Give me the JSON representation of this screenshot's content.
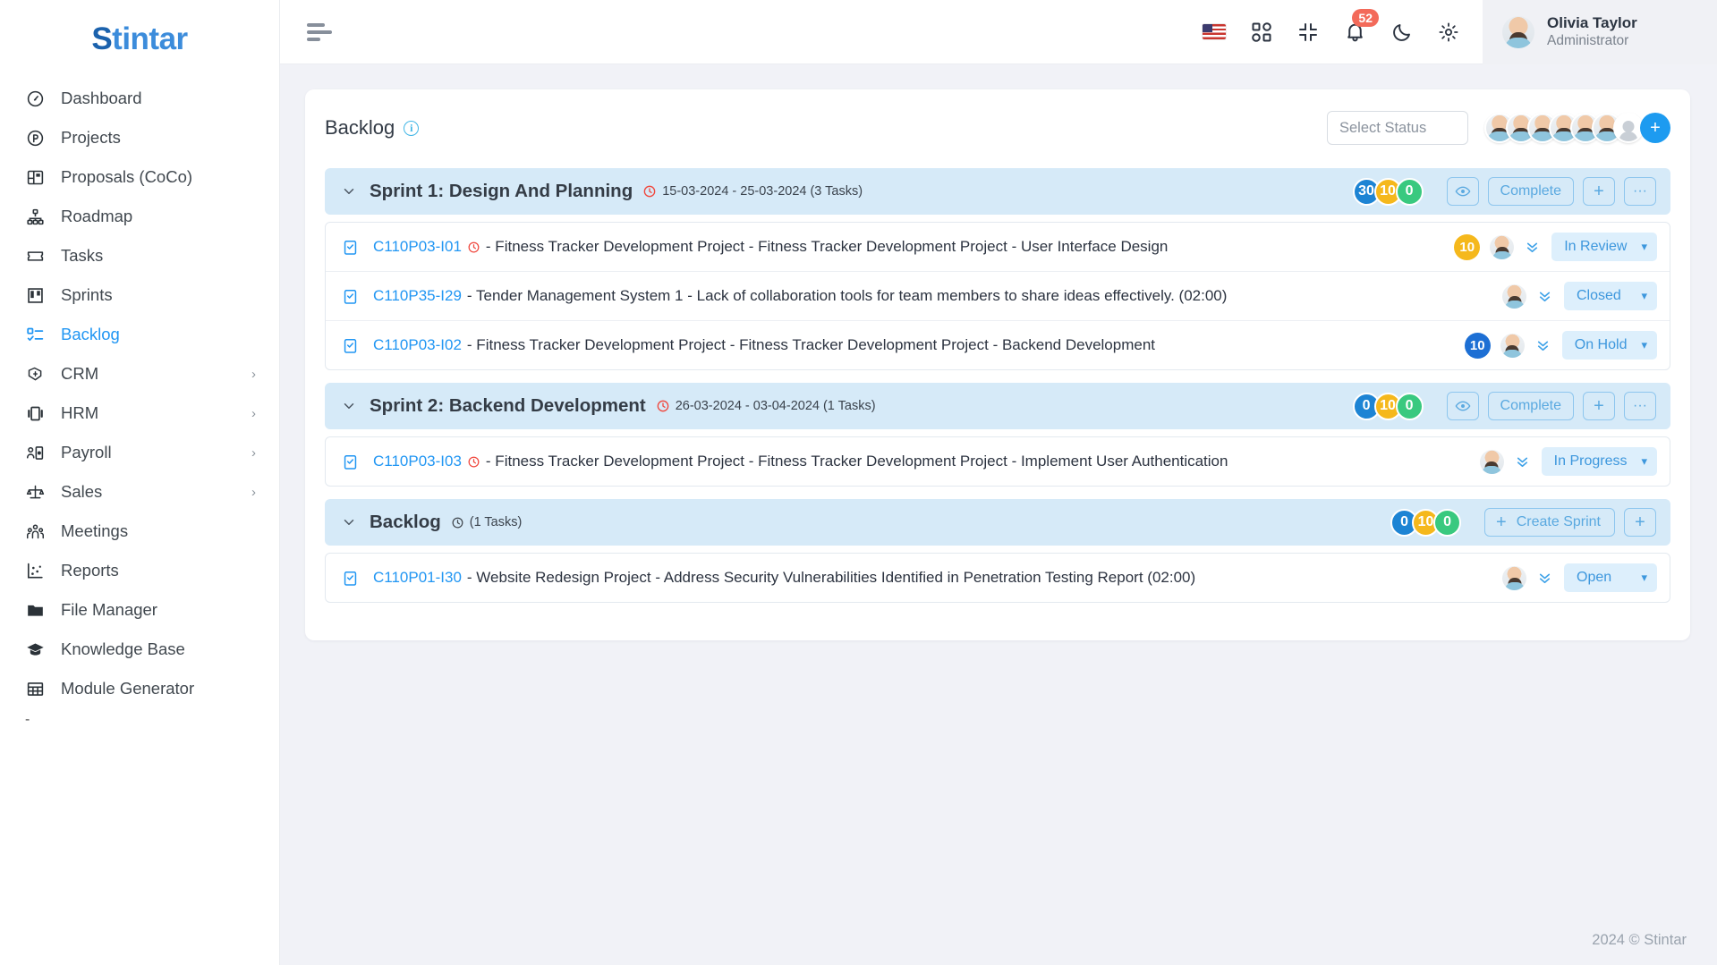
{
  "brand": {
    "prefix": "S",
    "rest": "tintar"
  },
  "sidebar": {
    "items": [
      {
        "label": "Dashboard",
        "icon": "gauge-icon",
        "active": false,
        "caret": ""
      },
      {
        "label": "Projects",
        "icon": "circle-p-icon",
        "active": false,
        "caret": ""
      },
      {
        "label": "Proposals (CoCo)",
        "icon": "layout-icon",
        "active": false,
        "caret": ""
      },
      {
        "label": "Roadmap",
        "icon": "sitemap-icon",
        "active": false,
        "caret": ""
      },
      {
        "label": "Tasks",
        "icon": "ticket-icon",
        "active": false,
        "caret": ""
      },
      {
        "label": "Sprints",
        "icon": "board-icon",
        "active": false,
        "caret": ""
      },
      {
        "label": "Backlog",
        "icon": "checklist-icon",
        "active": true,
        "caret": ""
      },
      {
        "label": "CRM",
        "icon": "handshake-icon",
        "active": false,
        "caret": "›"
      },
      {
        "label": "HRM",
        "icon": "id-card-icon",
        "active": false,
        "caret": "›"
      },
      {
        "label": "Payroll",
        "icon": "payroll-icon",
        "active": false,
        "caret": "›"
      },
      {
        "label": "Sales",
        "icon": "scales-icon",
        "active": false,
        "caret": "›"
      },
      {
        "label": "Meetings",
        "icon": "people-icon",
        "active": false,
        "caret": ""
      },
      {
        "label": "Reports",
        "icon": "scatter-chart-icon",
        "active": false,
        "caret": ""
      },
      {
        "label": "File Manager",
        "icon": "folder-icon",
        "active": false,
        "caret": ""
      },
      {
        "label": "Knowledge Base",
        "icon": "graduation-cap-icon",
        "active": false,
        "caret": ""
      },
      {
        "label": "Module Generator",
        "icon": "grid-table-icon",
        "active": false,
        "caret": ""
      }
    ],
    "trailing": "-"
  },
  "topbar": {
    "menu_toggle": "hamburger-icon",
    "language_flag": "us-flag-icon",
    "apps_icon": "apps-grid-icon",
    "collapse_icon": "collapse-icon",
    "notification_icon": "bell-icon",
    "notification_count": "52",
    "theme_icon": "moon-icon",
    "settings_icon": "gear-icon",
    "user": {
      "name": "Olivia Taylor",
      "role": "Administrator"
    }
  },
  "page": {
    "title": "Backlog",
    "info_glyph": "i",
    "status_filter_placeholder": "Select Status",
    "avatar_count": 6,
    "add_member_label": "+"
  },
  "groups": [
    {
      "name": "Sprint 1: Design And Planning",
      "bold": true,
      "show_clock": true,
      "meta": "15-03-2024 - 25-03-2024 (3 Tasks)",
      "counters": [
        {
          "value": "30",
          "color": "c-blue"
        },
        {
          "value": "10",
          "color": "c-yellow"
        },
        {
          "value": "0",
          "color": "c-green"
        }
      ],
      "buttons": [
        {
          "label": "",
          "kind": "eye",
          "name": "preview-sprint-button"
        },
        {
          "label": "Complete",
          "kind": "text",
          "name": "complete-sprint-button"
        },
        {
          "label": "+",
          "kind": "plus",
          "name": "add-task-button"
        },
        {
          "label": "···",
          "kind": "more",
          "name": "sprint-more-button"
        }
      ],
      "tasks": [
        {
          "key": "C110P03-I01",
          "clock": true,
          "text": "- Fitness Tracker Development Project - Fitness Tracker Development Project - User Interface Design",
          "estimate": "10",
          "estimate_color": "yellow",
          "status": "In Review"
        },
        {
          "key": "C110P35-I29",
          "clock": false,
          "text": "- Tender Management System 1 - Lack of collaboration tools for team members to share ideas effectively. (02:00)",
          "estimate": "",
          "estimate_color": "",
          "status": "Closed"
        },
        {
          "key": "C110P03-I02",
          "clock": false,
          "text": "- Fitness Tracker Development Project - Fitness Tracker Development Project - Backend Development",
          "estimate": "10",
          "estimate_color": "blue",
          "status": "On Hold"
        }
      ]
    },
    {
      "name": "Sprint 2: Backend Development",
      "bold": true,
      "show_clock": true,
      "meta": "26-03-2024 - 03-04-2024 (1 Tasks)",
      "counters": [
        {
          "value": "0",
          "color": "c-blue"
        },
        {
          "value": "10",
          "color": "c-yellow"
        },
        {
          "value": "0",
          "color": "c-green"
        }
      ],
      "buttons": [
        {
          "label": "",
          "kind": "eye",
          "name": "preview-sprint-button"
        },
        {
          "label": "Complete",
          "kind": "text",
          "name": "complete-sprint-button"
        },
        {
          "label": "+",
          "kind": "plus",
          "name": "add-task-button"
        },
        {
          "label": "···",
          "kind": "more",
          "name": "sprint-more-button"
        }
      ],
      "tasks": [
        {
          "key": "C110P03-I03",
          "clock": true,
          "text": "- Fitness Tracker Development Project - Fitness Tracker Development Project - Implement User Authentication",
          "estimate": "",
          "estimate_color": "",
          "status": "In Progress"
        }
      ]
    },
    {
      "name": "Backlog",
      "bold": false,
      "show_clock": true,
      "meta": "(1 Tasks)",
      "counters": [
        {
          "value": "0",
          "color": "c-blue"
        },
        {
          "value": "10",
          "color": "c-yellow"
        },
        {
          "value": "0",
          "color": "c-green"
        }
      ],
      "buttons": [
        {
          "label": "Create Sprint",
          "kind": "create",
          "name": "create-sprint-button"
        },
        {
          "label": "+",
          "kind": "plus",
          "name": "add-task-button"
        }
      ],
      "tasks": [
        {
          "key": "C110P01-I30",
          "clock": false,
          "text": "- Website Redesign Project - Address Security Vulnerabilities Identified in Penetration Testing Report (02:00)",
          "estimate": "",
          "estimate_color": "",
          "status": "Open"
        }
      ]
    }
  ],
  "footer": {
    "copyright": "2024 © Stintar"
  },
  "colors": {
    "accent": "#2196f3",
    "group_header_bg": "#d6eaf8",
    "counter_blue": "#1d84d4",
    "counter_yellow": "#f5b81c",
    "counter_green": "#39c97f",
    "clock_red": "#f0483e",
    "notif_badge": "#f36a5a"
  }
}
